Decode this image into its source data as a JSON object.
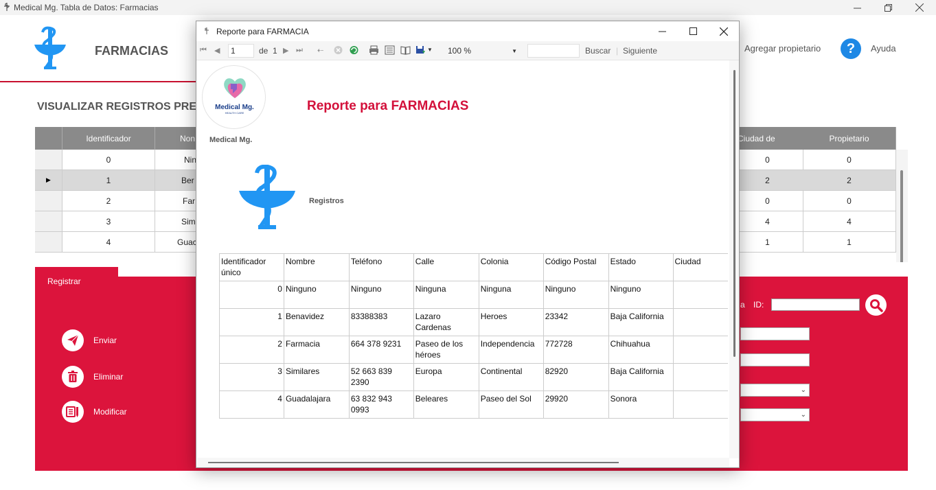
{
  "main_window": {
    "title": "Medical Mg. Tabla de Datos: Farmacias",
    "brand_title": "FARMACIAS",
    "add_owner": "Agregar propietario",
    "help": "Ayuda",
    "section_title": "VISUALIZAR REGISTROS PRE"
  },
  "grid": {
    "columns": [
      "Identificador",
      "Non",
      "Ciudad de",
      "Propietario"
    ],
    "rows": [
      {
        "id": "0",
        "name": "Nin",
        "city": "0",
        "owner": "0"
      },
      {
        "id": "1",
        "name": "Ber",
        "city": "2",
        "owner": "2"
      },
      {
        "id": "2",
        "name": "Far",
        "city": "0",
        "owner": "0"
      },
      {
        "id": "3",
        "name": "Sim",
        "city": "4",
        "owner": "4"
      },
      {
        "id": "4",
        "name": "Guac",
        "city": "1",
        "owner": "1"
      }
    ]
  },
  "form": {
    "tab": "Registrar",
    "buttons": {
      "send": "Enviar",
      "delete": "Eliminar",
      "modify": "Modificar"
    },
    "id_label_prefix": "a",
    "id_label": "ID:"
  },
  "report_window": {
    "title": "Reporte para FARMACIA",
    "toolbar": {
      "page_current": "1",
      "page_of": "de",
      "page_total": "1",
      "zoom": "100 %",
      "search": "Buscar",
      "next": "Siguiente"
    },
    "logo_name": "Medical Mg.",
    "logo_sub": "HEALTH CARE",
    "logo_caption": "Medical Mg.",
    "report_title": "Reporte para FARMACIAS",
    "section_label": "Registros",
    "table": {
      "headers": [
        "Identificador único",
        "Nombre",
        "Teléfono",
        "Calle",
        "Colonia",
        "Código Postal",
        "Estado",
        "Ciudad"
      ],
      "rows": [
        [
          "0",
          "Ninguno",
          "Ninguno",
          "Ninguna",
          "Ninguna",
          "Ninguno",
          "Ninguno",
          ""
        ],
        [
          "1",
          "Benavidez",
          "83388383",
          "Lazaro Cardenas",
          "Heroes",
          "23342",
          "Baja California",
          ""
        ],
        [
          "2",
          "Farmacia",
          "664 378 9231",
          "Paseo de los héroes",
          "Independencia",
          "772728",
          "Chihuahua",
          ""
        ],
        [
          "3",
          "Similares",
          "52 663 839 2390",
          "Europa",
          "Continental",
          "82920",
          "Baja California",
          ""
        ],
        [
          "4",
          "Guadalajara",
          "63 832 943 0993",
          "Beleares",
          "Paseo del Sol",
          "29920",
          "Sonora",
          ""
        ]
      ]
    }
  },
  "colors": {
    "accent_red": "#dc143c",
    "title_red": "#d3103a",
    "help_blue": "#1e88e5",
    "logo_blue": "#2196f3"
  }
}
